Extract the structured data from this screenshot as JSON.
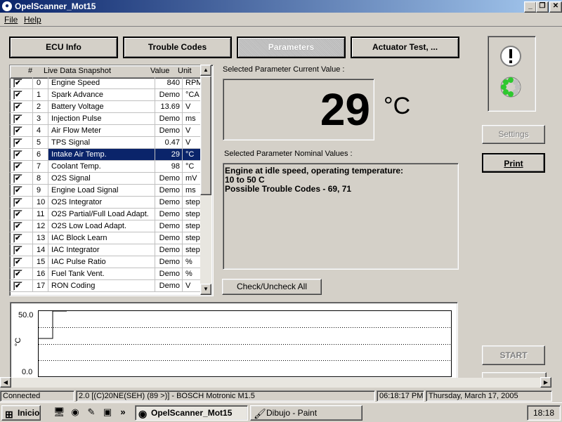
{
  "window": {
    "title": "OpelScanner_Mot15",
    "controls": [
      "_",
      "❐",
      "✕"
    ]
  },
  "menu": [
    {
      "label": "File"
    },
    {
      "label": "Help"
    }
  ],
  "tabs": [
    {
      "label": "ECU Info"
    },
    {
      "label": "Trouble Codes"
    },
    {
      "label": "Parameters"
    },
    {
      "label": "Actuator Test, ..."
    }
  ],
  "table": {
    "headers": {
      "num": "#",
      "name": "Live Data Snapshot",
      "value": "Value",
      "unit": "Unit"
    },
    "selected_index": 6,
    "rows": [
      {
        "num": "0",
        "name": "Engine Speed",
        "value": "840",
        "unit": "RPM",
        "checked": true
      },
      {
        "num": "1",
        "name": "Spark Advance",
        "value": "Demo",
        "unit": "°CA",
        "checked": true
      },
      {
        "num": "2",
        "name": "Battery Voltage",
        "value": "13.69",
        "unit": "V",
        "checked": true
      },
      {
        "num": "3",
        "name": "Injection Pulse",
        "value": "Demo",
        "unit": "ms",
        "checked": true
      },
      {
        "num": "4",
        "name": "Air Flow Meter",
        "value": "Demo",
        "unit": "V",
        "checked": true
      },
      {
        "num": "5",
        "name": "TPS Signal",
        "value": "0.47",
        "unit": "V",
        "checked": true
      },
      {
        "num": "6",
        "name": "Intake Air Temp.",
        "value": "29",
        "unit": "°C",
        "checked": true
      },
      {
        "num": "7",
        "name": "Coolant Temp.",
        "value": "98",
        "unit": "°C",
        "checked": true
      },
      {
        "num": "8",
        "name": "O2S Signal",
        "value": "Demo",
        "unit": "mV",
        "checked": true
      },
      {
        "num": "9",
        "name": "Engine Load Signal",
        "value": "Demo",
        "unit": "ms",
        "checked": true
      },
      {
        "num": "10",
        "name": "O2S Integrator",
        "value": "Demo",
        "unit": "steps",
        "checked": true
      },
      {
        "num": "11",
        "name": "O2S Partial/Full Load Adapt.",
        "value": "Demo",
        "unit": "steps",
        "checked": true
      },
      {
        "num": "12",
        "name": "O2S Low Load Adapt.",
        "value": "Demo",
        "unit": "steps",
        "checked": true
      },
      {
        "num": "13",
        "name": "IAC Block Learn",
        "value": "Demo",
        "unit": "steps",
        "checked": true
      },
      {
        "num": "14",
        "name": "IAC Integrator",
        "value": "Demo",
        "unit": "steps",
        "checked": true
      },
      {
        "num": "15",
        "name": "IAC Pulse Ratio",
        "value": "Demo",
        "unit": "%",
        "checked": true
      },
      {
        "num": "16",
        "name": "Fuel Tank Vent.",
        "value": "Demo",
        "unit": "%",
        "checked": true
      },
      {
        "num": "17",
        "name": "RON Coding",
        "value": "Demo",
        "unit": "V",
        "checked": true
      }
    ]
  },
  "current": {
    "label": "Selected Parameter Current Value :",
    "value": "29",
    "unit": "°C"
  },
  "nominal": {
    "label": "Selected Parameter Nominal Values :",
    "lines": [
      "Engine at idle speed, operating temperature:",
      "10 to 50 C",
      "Possible Trouble Codes - 69, 71"
    ]
  },
  "buttons": {
    "check_all": "Check/Uncheck All",
    "settings": "Settings",
    "print": "Print",
    "start": "START"
  },
  "status_icons": {
    "top": "exclamation-icon",
    "bottom": "connection-status-icon",
    "accent": "#2ec82e"
  },
  "chart_data": {
    "type": "line",
    "ylabel": "°C",
    "yticks": [
      "50.0",
      "0.0"
    ],
    "ylim": [
      0,
      50
    ],
    "grid": true,
    "series": [
      {
        "x": [
          0,
          1,
          1,
          2
        ],
        "y": [
          29,
          29,
          50,
          50
        ]
      }
    ]
  },
  "statusbar": {
    "state": "Connected",
    "ecu": "2.0 [(C)20NE(SEH)  (89 >)] - BOSCH Motronic M1.5",
    "time": "06:18:17 PM",
    "date": "Thursday, March 17, 2005"
  },
  "taskbar": {
    "start_label": "Inicio",
    "quicklaunch": [
      "desktop-icon",
      "browser-icon",
      "media-icon",
      "app-icon"
    ],
    "more": "»",
    "tasks": [
      {
        "label": "OpelScanner_Mot15",
        "active": true
      },
      {
        "label": "Dibujo - Paint",
        "active": false
      }
    ],
    "clock": "18:18"
  }
}
